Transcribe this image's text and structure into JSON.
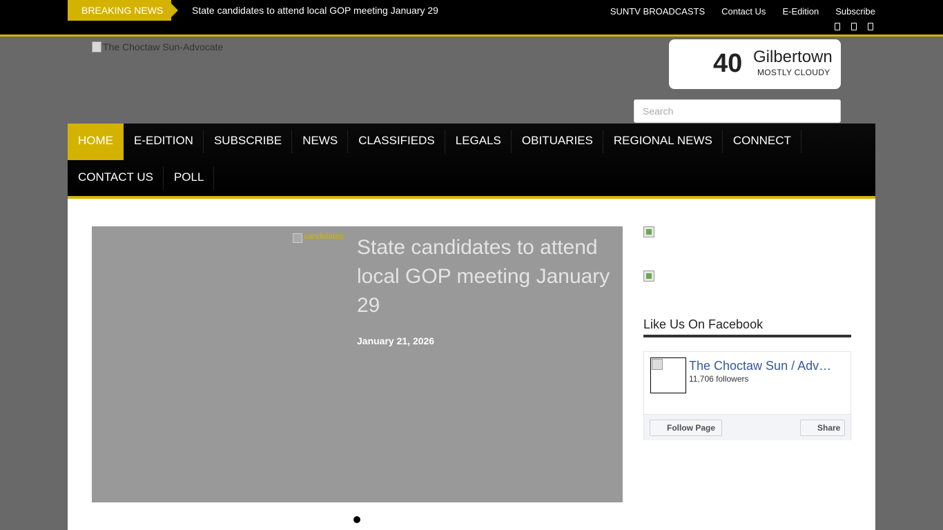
{
  "topbar": {
    "breaking_label": "BREAKING NEWS",
    "breaking_headline": "State candidates to attend local GOP meeting January 29",
    "links": [
      "SUNTV BROADCASTS",
      "Contact Us",
      "E-Edition",
      "Subscribe"
    ],
    "social_icons": [
      "facebook-icon",
      "twitter-icon",
      "instagram-icon"
    ]
  },
  "header": {
    "logo_alt": "The Choctaw Sun-Advocate",
    "weather": {
      "temperature": "40",
      "city": "Gilbertown",
      "condition": "MOSTLY CLOUDY"
    },
    "search_placeholder": "Search"
  },
  "nav": {
    "row1": [
      "HOME",
      "E-EDITION",
      "SUBSCRIBE",
      "NEWS",
      "CLASSIFIEDS",
      "LEGALS",
      "OBITUARIES",
      "REGIONAL NEWS",
      "CONNECT"
    ],
    "row2": [
      "CONTACT US",
      "POLL"
    ],
    "active": "HOME"
  },
  "slider": {
    "image_alt": "candidates",
    "title": "State candidates to attend local GOP meeting January 29",
    "date": "January 21, 2026"
  },
  "sidebar": {
    "facebook_title": "Like Us On Facebook",
    "fb_page_name": "The Choctaw Sun / Advocate",
    "fb_followers": "11,706 followers",
    "fb_follow_label": "Follow Page",
    "fb_share_label": "Share"
  },
  "colors": {
    "accent": "#d4b300",
    "background": "#696969",
    "nav": "#000000"
  }
}
